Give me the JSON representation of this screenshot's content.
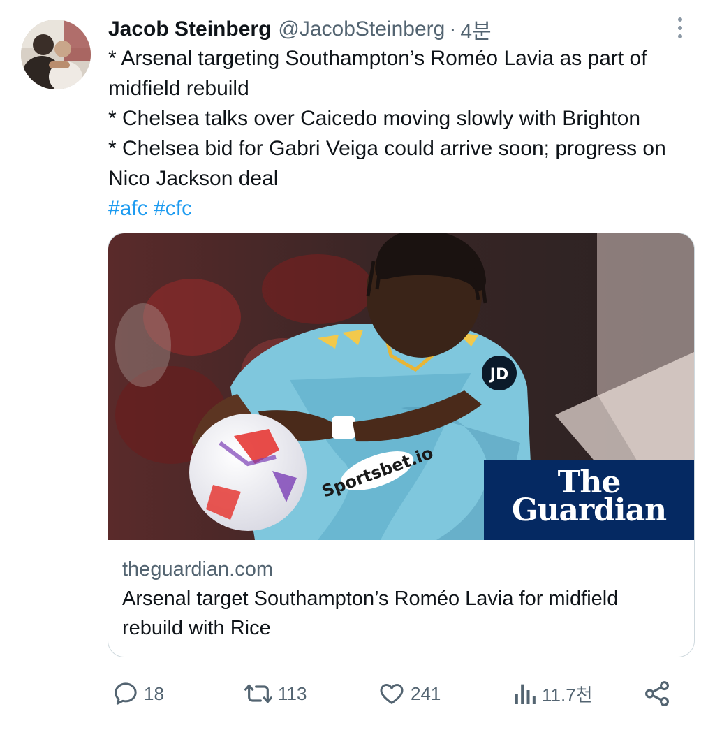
{
  "tweet": {
    "author": {
      "display_name": "Jacob Steinberg",
      "handle": "@JacobSteinberg",
      "separator": "·",
      "time": "4분"
    },
    "lines": [
      "* Arsenal targeting Southampton’s Roméo Lavia as part of midfield rebuild",
      "* Chelsea talks over Caicedo moving slowly with Brighton",
      "* Chelsea bid for Gabri Veiga could arrive soon; progress on Nico Jackson deal"
    ],
    "hashtags": [
      "#afc",
      "#cfc"
    ],
    "card": {
      "logo_line1": "The",
      "logo_line2": "Guardian",
      "domain": "theguardian.com",
      "title": "Arsenal target Southampton’s Roméo Lavia for midfield rebuild with Rice"
    },
    "actions": {
      "replies": "18",
      "reposts": "113",
      "likes": "241",
      "views": "11.7천"
    }
  },
  "colors": {
    "text": "#0f1419",
    "secondary": "#536471",
    "link": "#1d9bf0",
    "guardian_blue": "#052962",
    "border": "#cfd9de"
  },
  "icons": {
    "more": "more-vertical-icon",
    "reply": "reply-icon",
    "repost": "repost-icon",
    "like": "heart-icon",
    "views": "views-chart-icon",
    "share": "share-icon"
  }
}
